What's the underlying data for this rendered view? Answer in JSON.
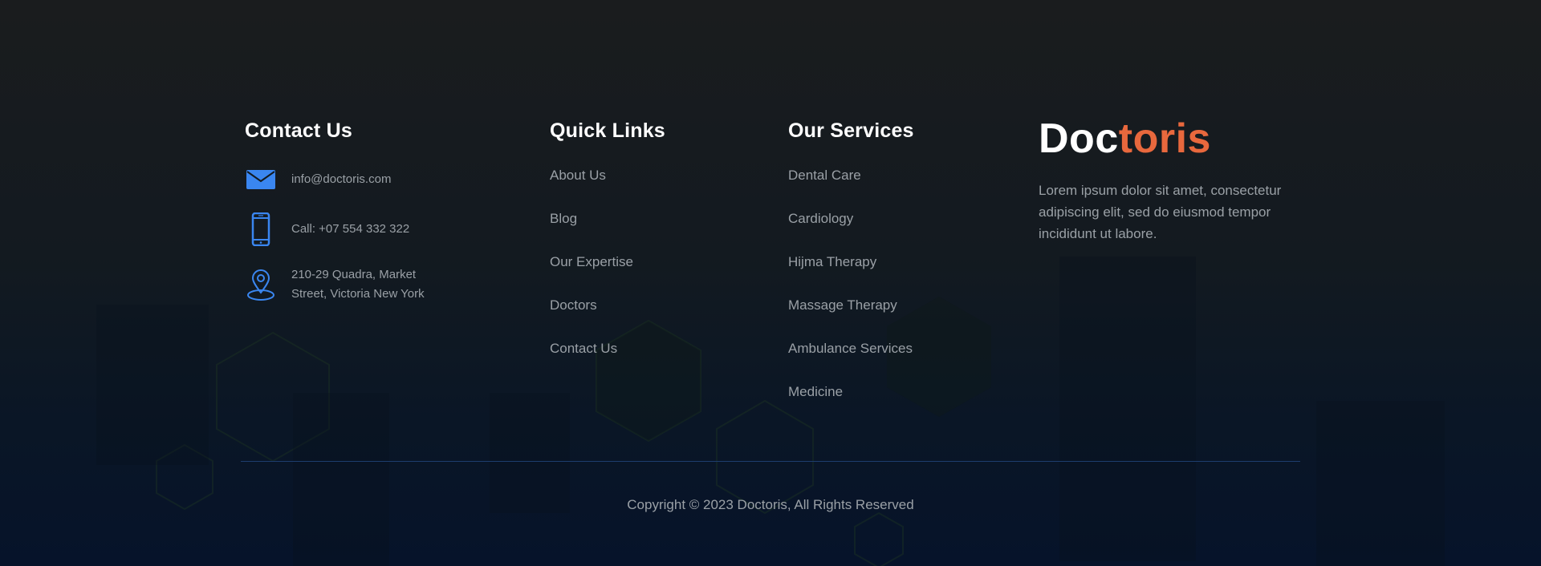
{
  "contact": {
    "title": "Contact Us",
    "email": "info@doctoris.com",
    "phone": "Call: +07 554 332 322",
    "address_line1": "210-29 Quadra, Market",
    "address_line2": "Street, Victoria New York",
    "icons": [
      "mail-icon",
      "phone-icon",
      "location-pin-icon"
    ],
    "icon_color": "#3a86f0"
  },
  "quick_links": {
    "title": "Quick Links",
    "items": [
      "About Us",
      "Blog",
      "Our Expertise",
      "Doctors",
      "Contact Us"
    ]
  },
  "services": {
    "title": "Our Services",
    "items": [
      "Dental Care",
      "Cardiology",
      "Hijma Therapy",
      "Massage Therapy",
      "Ambulance Services",
      "Medicine"
    ]
  },
  "brand": {
    "name_part1": "Doc",
    "name_part2": "toris",
    "accent_color": "#e8683d",
    "description": "Lorem ipsum dolor sit amet, consectetur adipiscing elit, sed do eiusmod tempor incididunt ut labore."
  },
  "footer": {
    "copyright": "Copyright © 2023 Doctoris, All Rights Reserved"
  }
}
